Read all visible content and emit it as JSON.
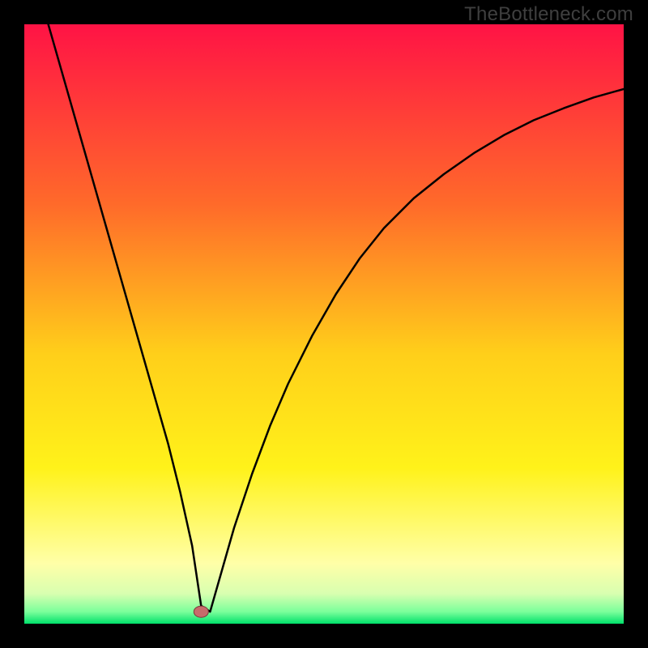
{
  "watermark": "TheBottleneck.com",
  "colors": {
    "topRed": "#ff1345",
    "midOrange": "#ff8a1f",
    "yellow": "#ffe61a",
    "paleYellow": "#ffffb0",
    "green": "#00e06a",
    "curve": "#000000",
    "marker": "#c76b6b",
    "markerStroke": "#7a3a3a",
    "frameBg": "#000000"
  },
  "chart_data": {
    "type": "line",
    "title": "",
    "xlabel": "",
    "ylabel": "",
    "xlim": [
      0,
      100
    ],
    "ylim": [
      0,
      100
    ],
    "series": [
      {
        "name": "bottleneck-curve",
        "x": [
          4,
          6,
          8,
          10,
          12,
          14,
          16,
          18,
          20,
          22,
          24,
          26,
          28,
          29.5,
          31,
          33,
          35,
          38,
          41,
          44,
          48,
          52,
          56,
          60,
          65,
          70,
          75,
          80,
          85,
          90,
          95,
          100
        ],
        "values": [
          100,
          93,
          86,
          79,
          72,
          65,
          58,
          51,
          44,
          37,
          30,
          22,
          13,
          3,
          2,
          9,
          16,
          25,
          33,
          40,
          48,
          55,
          61,
          66,
          71,
          75,
          78.5,
          81.5,
          84,
          86,
          87.8,
          89.2
        ]
      }
    ],
    "marker": {
      "x": 29.5,
      "y": 2
    },
    "gradient_stops_pct": [
      {
        "offset": 0,
        "color": "#ff1345"
      },
      {
        "offset": 30,
        "color": "#ff6a2a"
      },
      {
        "offset": 55,
        "color": "#ffcf1a"
      },
      {
        "offset": 74,
        "color": "#fff21a"
      },
      {
        "offset": 90,
        "color": "#ffffa8"
      },
      {
        "offset": 95,
        "color": "#d8ffb0"
      },
      {
        "offset": 98,
        "color": "#7bff9b"
      },
      {
        "offset": 100,
        "color": "#00e06a"
      }
    ]
  }
}
